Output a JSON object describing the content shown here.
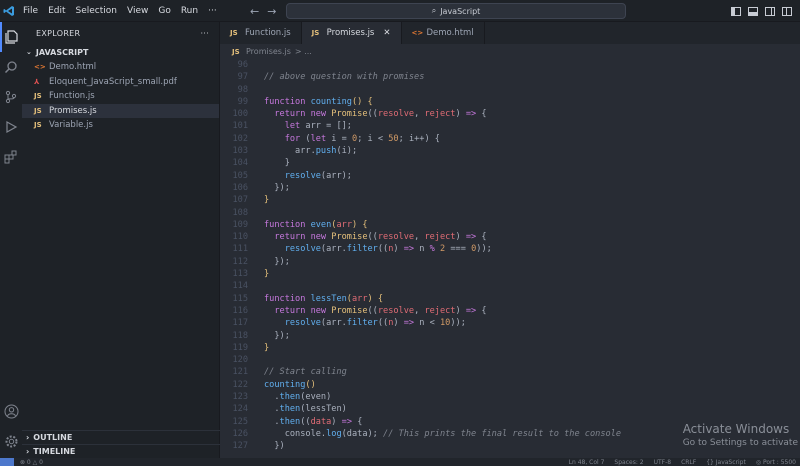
{
  "menu": [
    "File",
    "Edit",
    "Selection",
    "View",
    "Go",
    "Run",
    "···"
  ],
  "search": {
    "text": "JavaScript"
  },
  "sidebar": {
    "header": "EXPLORER",
    "more": "···",
    "folder": "JAVASCRIPT",
    "files": [
      {
        "name": "Demo.html",
        "icon": "html-icon",
        "glyph": "<>",
        "color": "#e37933",
        "selected": false
      },
      {
        "name": "Eloquent_JavaScript_small.pdf",
        "icon": "pdf-icon",
        "glyph": "⅄",
        "color": "#e05252",
        "selected": false
      },
      {
        "name": "Function.js",
        "icon": "js-icon",
        "glyph": "JS",
        "color": "#e5c07b",
        "selected": false
      },
      {
        "name": "Promises.js",
        "icon": "js-icon",
        "glyph": "JS",
        "color": "#e5c07b",
        "selected": true
      },
      {
        "name": "Variable.js",
        "icon": "js-icon",
        "glyph": "JS",
        "color": "#e5c07b",
        "selected": false
      }
    ],
    "outline": "OUTLINE",
    "timeline": "TIMELINE"
  },
  "tabs": [
    {
      "label": "Function.js",
      "glyph": "JS",
      "color": "#e5c07b",
      "active": false
    },
    {
      "label": "Promises.js",
      "glyph": "JS",
      "color": "#e5c07b",
      "active": true,
      "close": "✕"
    },
    {
      "label": "Demo.html",
      "glyph": "<>",
      "color": "#e37933",
      "active": false
    }
  ],
  "breadcrumb": {
    "glyph": "JS",
    "file": "Promises.js",
    "rest": "> ..."
  },
  "code": [
    {
      "n": "96",
      "t": []
    },
    {
      "n": "97",
      "t": [
        [
          "c",
          "// above question with promises"
        ]
      ]
    },
    {
      "n": "98",
      "t": []
    },
    {
      "n": "99",
      "t": [
        [
          "k",
          "function "
        ],
        [
          "f",
          "counting"
        ],
        [
          "y",
          "() {"
        ]
      ]
    },
    {
      "n": "100",
      "t": [
        [
          "b",
          "  "
        ],
        [
          "k",
          "return new "
        ],
        [
          "y",
          "Promise"
        ],
        [
          "b",
          "(("
        ],
        [
          "p",
          "resolve"
        ],
        [
          "b",
          ", "
        ],
        [
          "p",
          "reject"
        ],
        [
          "b",
          ") "
        ],
        [
          "k",
          "=>"
        ],
        [
          "b",
          " {"
        ]
      ]
    },
    {
      "n": "101",
      "t": [
        [
          "b",
          "    "
        ],
        [
          "k",
          "let "
        ],
        [
          "b",
          "arr = [];"
        ]
      ]
    },
    {
      "n": "102",
      "t": [
        [
          "b",
          "    "
        ],
        [
          "k",
          "for "
        ],
        [
          "b",
          "("
        ],
        [
          "k",
          "let "
        ],
        [
          "b",
          "i = "
        ],
        [
          "n",
          "0"
        ],
        [
          "b",
          "; i < "
        ],
        [
          "n",
          "50"
        ],
        [
          "b",
          "; i++) {"
        ]
      ]
    },
    {
      "n": "103",
      "t": [
        [
          "b",
          "      arr."
        ],
        [
          "f",
          "push"
        ],
        [
          "b",
          "(i);"
        ]
      ]
    },
    {
      "n": "104",
      "t": [
        [
          "b",
          "    }"
        ]
      ]
    },
    {
      "n": "105",
      "t": [
        [
          "b",
          "    "
        ],
        [
          "f",
          "resolve"
        ],
        [
          "b",
          "(arr);"
        ]
      ]
    },
    {
      "n": "106",
      "t": [
        [
          "b",
          "  });"
        ]
      ]
    },
    {
      "n": "107",
      "t": [
        [
          "y",
          "}"
        ]
      ]
    },
    {
      "n": "108",
      "t": []
    },
    {
      "n": "109",
      "t": [
        [
          "k",
          "function "
        ],
        [
          "f",
          "even"
        ],
        [
          "y",
          "("
        ],
        [
          "p",
          "arr"
        ],
        [
          "y",
          ") {"
        ]
      ]
    },
    {
      "n": "110",
      "t": [
        [
          "b",
          "  "
        ],
        [
          "k",
          "return new "
        ],
        [
          "y",
          "Promise"
        ],
        [
          "b",
          "(("
        ],
        [
          "p",
          "resolve"
        ],
        [
          "b",
          ", "
        ],
        [
          "p",
          "reject"
        ],
        [
          "b",
          ") "
        ],
        [
          "k",
          "=>"
        ],
        [
          "b",
          " {"
        ]
      ]
    },
    {
      "n": "111",
      "t": [
        [
          "b",
          "    "
        ],
        [
          "f",
          "resolve"
        ],
        [
          "b",
          "(arr."
        ],
        [
          "f",
          "filter"
        ],
        [
          "b",
          "(("
        ],
        [
          "p",
          "n"
        ],
        [
          "b",
          ") "
        ],
        [
          "k",
          "=>"
        ],
        [
          "b",
          " n "
        ],
        [
          "k",
          "%"
        ],
        [
          "b",
          " "
        ],
        [
          "n",
          "2"
        ],
        [
          "b",
          " === "
        ],
        [
          "n",
          "0"
        ],
        [
          "b",
          "));"
        ]
      ]
    },
    {
      "n": "112",
      "t": [
        [
          "b",
          "  });"
        ]
      ]
    },
    {
      "n": "113",
      "t": [
        [
          "y",
          "}"
        ]
      ]
    },
    {
      "n": "114",
      "t": []
    },
    {
      "n": "115",
      "t": [
        [
          "k",
          "function "
        ],
        [
          "f",
          "lessTen"
        ],
        [
          "y",
          "("
        ],
        [
          "p",
          "arr"
        ],
        [
          "y",
          ") {"
        ]
      ]
    },
    {
      "n": "116",
      "t": [
        [
          "b",
          "  "
        ],
        [
          "k",
          "return new "
        ],
        [
          "y",
          "Promise"
        ],
        [
          "b",
          "(("
        ],
        [
          "p",
          "resolve"
        ],
        [
          "b",
          ", "
        ],
        [
          "p",
          "reject"
        ],
        [
          "b",
          ") "
        ],
        [
          "k",
          "=>"
        ],
        [
          "b",
          " {"
        ]
      ]
    },
    {
      "n": "117",
      "t": [
        [
          "b",
          "    "
        ],
        [
          "f",
          "resolve"
        ],
        [
          "b",
          "(arr."
        ],
        [
          "f",
          "filter"
        ],
        [
          "b",
          "(("
        ],
        [
          "p",
          "n"
        ],
        [
          "b",
          ") "
        ],
        [
          "k",
          "=>"
        ],
        [
          "b",
          " n < "
        ],
        [
          "n",
          "10"
        ],
        [
          "b",
          "));"
        ]
      ]
    },
    {
      "n": "118",
      "t": [
        [
          "b",
          "  });"
        ]
      ]
    },
    {
      "n": "119",
      "t": [
        [
          "y",
          "}"
        ]
      ]
    },
    {
      "n": "120",
      "t": []
    },
    {
      "n": "121",
      "t": [
        [
          "c",
          "// Start calling"
        ]
      ]
    },
    {
      "n": "122",
      "t": [
        [
          "f",
          "counting"
        ],
        [
          "y",
          "()"
        ]
      ]
    },
    {
      "n": "123",
      "t": [
        [
          "b",
          "  ."
        ],
        [
          "f",
          "then"
        ],
        [
          "b",
          "(even)"
        ]
      ]
    },
    {
      "n": "124",
      "t": [
        [
          "b",
          "  ."
        ],
        [
          "f",
          "then"
        ],
        [
          "b",
          "(lessTen)"
        ]
      ]
    },
    {
      "n": "125",
      "t": [
        [
          "b",
          "  ."
        ],
        [
          "f",
          "then"
        ],
        [
          "b",
          "(("
        ],
        [
          "p",
          "data"
        ],
        [
          "b",
          ") "
        ],
        [
          "k",
          "=>"
        ],
        [
          "b",
          " {"
        ]
      ]
    },
    {
      "n": "126",
      "t": [
        [
          "b",
          "    console."
        ],
        [
          "f",
          "log"
        ],
        [
          "b",
          "(data); "
        ],
        [
          "c",
          "// This prints the final result to the console"
        ]
      ]
    },
    {
      "n": "127",
      "t": [
        [
          "b",
          "  })"
        ]
      ]
    }
  ],
  "activate": {
    "title": "Activate Windows",
    "sub": "Go to Settings to activate"
  },
  "statusbar": {
    "left": "⊗ 0 △ 0",
    "items": [
      "Ln 48, Col 7",
      "Spaces: 2",
      "UTF-8",
      "CRLF",
      "{} JavaScript",
      "◎ Port : 5500"
    ]
  },
  "colors": {
    "accent": "#528bff",
    "remote": "#4d78cc",
    "editor_bg": "#282c34",
    "sidebar_bg": "#1e2227"
  }
}
